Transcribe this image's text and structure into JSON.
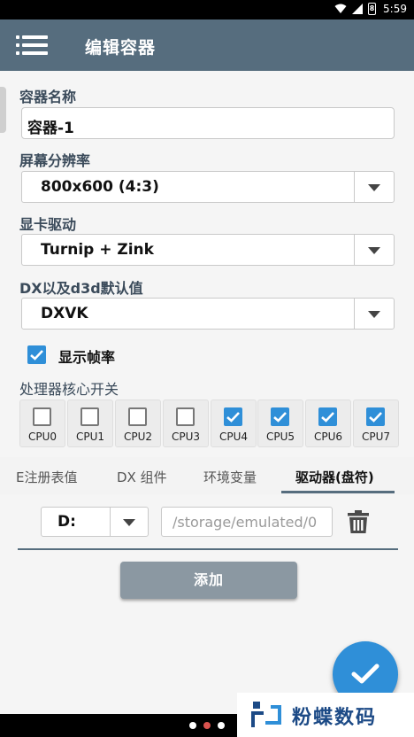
{
  "status_bar": {
    "battery_level": "8",
    "time": "5:59"
  },
  "app_bar": {
    "title": "编辑容器"
  },
  "form": {
    "name_label": "容器名称",
    "name_value": "容器-1",
    "resolution_label": "屏幕分辨率",
    "resolution_value": "800x600 (4:3)",
    "driver_label": "显卡驱动",
    "driver_value": "Turnip + Zink",
    "dx_label": "DX以及d3d默认值",
    "dx_value": "DXVK",
    "show_fps_label": "显示帧率",
    "show_fps_checked": true,
    "cpu_label": "处理器核心开关",
    "cpus": [
      {
        "label": "CPU0",
        "checked": false
      },
      {
        "label": "CPU1",
        "checked": false
      },
      {
        "label": "CPU2",
        "checked": false
      },
      {
        "label": "CPU3",
        "checked": false
      },
      {
        "label": "CPU4",
        "checked": true
      },
      {
        "label": "CPU5",
        "checked": true
      },
      {
        "label": "CPU6",
        "checked": true
      },
      {
        "label": "CPU7",
        "checked": true
      }
    ]
  },
  "tabs": [
    {
      "label": "E注册表值",
      "active": false
    },
    {
      "label": "DX 组件",
      "active": false
    },
    {
      "label": "环境变量",
      "active": false
    },
    {
      "label": "驱动器(盘符)",
      "active": true
    }
  ],
  "drive": {
    "letter": "D:",
    "path_placeholder": "/storage/emulated/0"
  },
  "add_button": "添加",
  "watermark": {
    "text": "粉蝶数码"
  },
  "colors": {
    "app_bar": "#566d7e",
    "accent": "#2f8fd8",
    "add_button": "#8b98a2"
  }
}
